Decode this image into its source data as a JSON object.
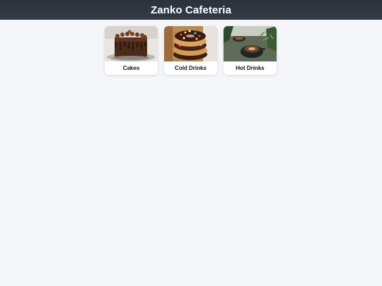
{
  "app": {
    "title": "Zanko Cafeteria"
  },
  "categories": [
    {
      "label": "Cakes",
      "image": "chocolate-cake"
    },
    {
      "label": "Cold Drinks",
      "image": "frosted-donuts"
    },
    {
      "label": "Hot Drinks",
      "image": "coffee-cups"
    }
  ],
  "colors": {
    "header_bg": "#2f3640",
    "page_bg": "#f4f6fa",
    "card_bg": "#ffffff"
  }
}
